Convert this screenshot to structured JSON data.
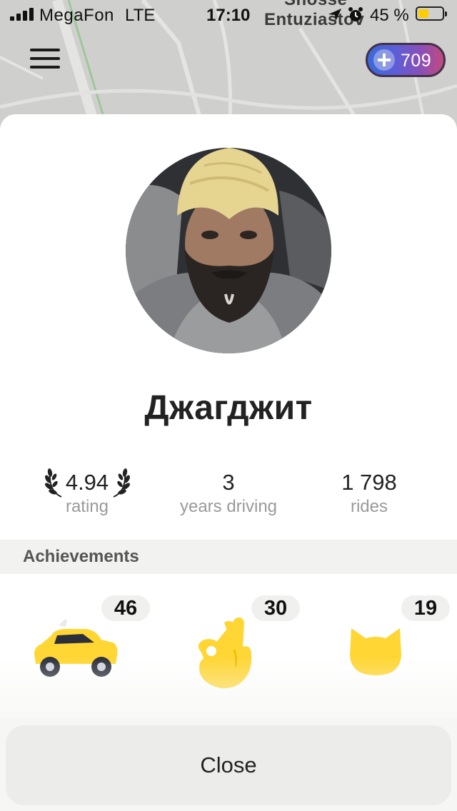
{
  "status_bar": {
    "carrier": "MegaFon",
    "network": "LTE",
    "time": "17:10",
    "battery_percent": "45 %",
    "battery_level": 0.45
  },
  "map": {
    "street_label": "Entuziastov",
    "street_label_top": "Shosse"
  },
  "plus": {
    "points": "709"
  },
  "driver": {
    "name": "Джагджит",
    "stats": {
      "rating": {
        "value": "4.94",
        "label": "rating"
      },
      "years": {
        "value": "3",
        "label": "years driving"
      },
      "rides": {
        "value": "1 798",
        "label": "rides"
      }
    }
  },
  "achievements": {
    "title": "Achievements",
    "items": [
      {
        "icon": "taxi-car-icon",
        "count": "46"
      },
      {
        "icon": "ok-hand-icon",
        "count": "30"
      },
      {
        "icon": "cat-face-icon",
        "count": "19"
      }
    ]
  },
  "close_button": {
    "label": "Close"
  },
  "colors": {
    "accent_yellow": "#ffd633",
    "sheet_background": "#ffffff",
    "section_background": "#f2f2f0",
    "muted_text": "#9a9a9a"
  }
}
